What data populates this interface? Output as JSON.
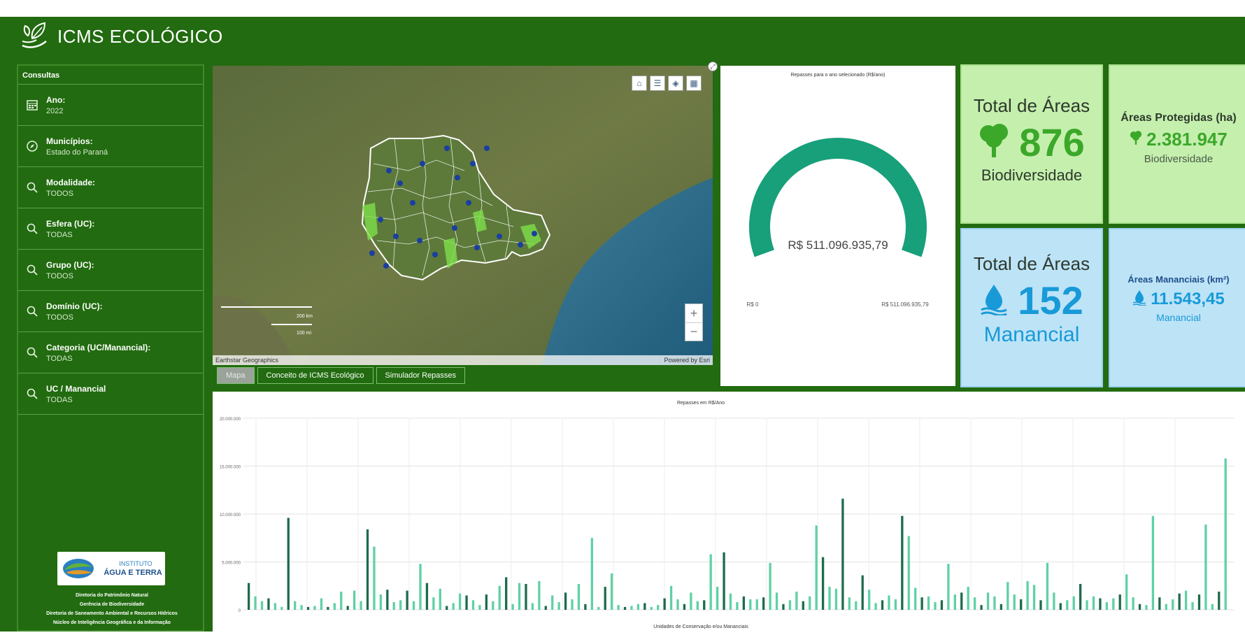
{
  "app": {
    "title": "ICMS ECOLÓGICO"
  },
  "sidebar": {
    "heading": "Consultas",
    "items": [
      {
        "label": "Ano:",
        "value": "2022",
        "icon": "calendar-icon"
      },
      {
        "label": "Municípios:",
        "value": "Estado do Paraná",
        "icon": "compass-icon"
      },
      {
        "label": "Modalidade:",
        "value": "TODOS",
        "icon": "search-icon"
      },
      {
        "label": "Esfera (UC):",
        "value": "TODAS",
        "icon": "search-icon"
      },
      {
        "label": "Grupo (UC):",
        "value": "TODOS",
        "icon": "search-icon"
      },
      {
        "label": "Domínio (UC):",
        "value": "TODOS",
        "icon": "search-icon"
      },
      {
        "label": "Categoria (UC/Manancial):",
        "value": "TODAS",
        "icon": "search-icon"
      },
      {
        "label": "UC / Manancial",
        "value": "TODAS",
        "icon": "search-icon"
      }
    ],
    "institute_logo_line1": "INSTITUTO",
    "institute_logo_line2": "ÁGUA E TERRA",
    "footer_lines": [
      "Diretoria do Patrimônio Natural",
      "Gerência de Biodiversidade",
      "Diretoria de Saneamento Ambiental e Recursos Hídricos",
      "Núcleo de Inteligência Geográfica e da Informação"
    ]
  },
  "map": {
    "attribution_left": "Earthstar Geographics",
    "attribution_right": "Powered by Esri",
    "scale_label_1": "200 km",
    "scale_label_2": "100 mi",
    "zoom_in": "+",
    "zoom_out": "−",
    "tools": [
      "home-icon",
      "legend-icon",
      "layers-icon",
      "basemap-gallery-icon"
    ]
  },
  "map_tabs": [
    {
      "label": "Mapa",
      "active": true
    },
    {
      "label": "Conceito de ICMS Ecológico",
      "active": false
    },
    {
      "label": "Simulador Repasses",
      "active": false
    }
  ],
  "gauge": {
    "title": "Repasses para o ano selecionado (R$/ano)",
    "value_label": "R$ 511.096.935,79",
    "min_label": "R$ 0",
    "max_label": "R$ 511.096.935,79",
    "fraction": 1.0,
    "color": "#17a07a"
  },
  "kpis": {
    "bio_total": {
      "title": "Total de Áreas",
      "value": "876",
      "subtitle": "Biodiversidade",
      "icon": "tree-icon"
    },
    "bio_area": {
      "title": "Áreas Protegidas (ha)",
      "value": "2.381.947",
      "subtitle": "Biodiversidade",
      "icon": "tree-icon"
    },
    "man_total": {
      "title": "Total de Áreas",
      "value": "152",
      "subtitle": "Manancial",
      "icon": "water-drop-icon"
    },
    "man_area": {
      "title": "Áreas Mananciais (km²)",
      "value": "11.543,45",
      "subtitle": "Manancial",
      "icon": "water-drop-icon"
    }
  },
  "colors": {
    "header_green": "#226b10",
    "bio_bg": "#c5efad",
    "man_bg": "#bde3f7",
    "bar_dark": "#1e6b4c",
    "bar_light": "#5fd1a4"
  },
  "chart_data": {
    "type": "bar",
    "title": "Repasses em R$/Ano",
    "xlabel": "Unidades de Conservação e/ou Mananciais",
    "ylabel": "",
    "ylim": [
      0,
      20000000
    ],
    "yticks": [
      "0",
      "5.000.000",
      "10.000.000",
      "15.000.000",
      "20.000.000"
    ],
    "grid": true,
    "values": [
      2800000,
      1400000,
      900000,
      1200000,
      700000,
      300000,
      9600000,
      900000,
      500000,
      300000,
      400000,
      1200000,
      300000,
      700000,
      1900000,
      400000,
      2000000,
      900000,
      8400000,
      6600000,
      1600000,
      2100000,
      800000,
      1000000,
      2000000,
      900000,
      4800000,
      2800000,
      1300000,
      2200000,
      400000,
      700000,
      1700000,
      1500000,
      1000000,
      500000,
      1600000,
      900000,
      2500000,
      3400000,
      600000,
      2800000,
      2700000,
      700000,
      3000000,
      400000,
      1500000,
      800000,
      1800000,
      1100000,
      2700000,
      600000,
      7500000,
      300000,
      2400000,
      3800000,
      500000,
      300000,
      400000,
      600000,
      700000,
      300000,
      500000,
      1200000,
      2500000,
      1100000,
      600000,
      1800000,
      900000,
      1000000,
      5800000,
      2400000,
      6000000,
      1700000,
      800000,
      1400000,
      1100000,
      1100000,
      1300000,
      4900000,
      1800000,
      600000,
      1000000,
      1900000,
      900000,
      1400000,
      8800000,
      5500000,
      2400000,
      2200000,
      11600000,
      1300000,
      900000,
      3600000,
      2100000,
      700000,
      1000000,
      1500000,
      1100000,
      9800000,
      7700000,
      2300000,
      1300000,
      1400000,
      800000,
      1000000,
      4800000,
      1600000,
      1800000,
      2400000,
      1300000,
      500000,
      1800000,
      1400000,
      600000,
      2900000,
      1600000,
      1100000,
      3000000,
      2600000,
      1000000,
      4900000,
      1800000,
      700000,
      1000000,
      1400000,
      2700000,
      1000000,
      1400000,
      1200000,
      800000,
      1200000,
      1600000,
      3700000,
      1300000,
      600000,
      500000,
      9800000,
      1300000,
      600000,
      1100000,
      1700000,
      2000000,
      800000,
      1600000,
      8900000,
      600000,
      1900000,
      15800000
    ]
  }
}
